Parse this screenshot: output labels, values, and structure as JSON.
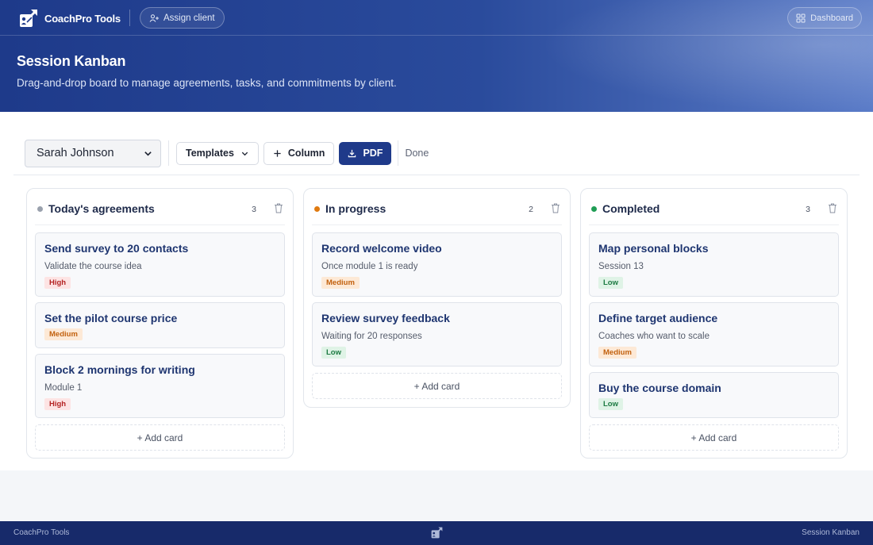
{
  "app": {
    "brand": "CoachPro Tools"
  },
  "topbar": {
    "assign_label": "Assign client",
    "dashboard_label": "Dashboard"
  },
  "hero": {
    "title": "Session Kanban",
    "subtitle": "Drag-and-drop board to manage agreements, tasks, and commitments by client."
  },
  "toolbar": {
    "client_selected": "Sarah Johnson",
    "templates_label": "Templates",
    "column_label": "Column",
    "pdf_label": "PDF",
    "status_label": "Done"
  },
  "colors": {
    "accent": "#1f3a8a",
    "dot_gray": "#9aa1ad",
    "dot_orange": "#e07a10",
    "dot_green": "#1f9d55"
  },
  "columns": [
    {
      "title": "Today's agreements",
      "count": "3",
      "cards": [
        {
          "title": "Send survey to 20 contacts",
          "subtitle": "Validate the course idea",
          "priority": "High"
        },
        {
          "title": "Set the pilot course price",
          "subtitle": "",
          "priority": "Medium"
        },
        {
          "title": "Block 2 mornings for writing",
          "subtitle": "Module 1",
          "priority": "High"
        }
      ],
      "add_label": "+ Add card"
    },
    {
      "title": "In progress",
      "count": "2",
      "cards": [
        {
          "title": "Record welcome video",
          "subtitle": "Once module 1 is ready",
          "priority": "Medium"
        },
        {
          "title": "Review survey feedback",
          "subtitle": "Waiting for 20 responses",
          "priority": "Low"
        }
      ],
      "add_label": "+ Add card"
    },
    {
      "title": "Completed",
      "count": "3",
      "cards": [
        {
          "title": "Map personal blocks",
          "subtitle": "Session 13",
          "priority": "Low"
        },
        {
          "title": "Define target audience",
          "subtitle": "Coaches who want to scale",
          "priority": "Medium"
        },
        {
          "title": "Buy the course domain",
          "subtitle": "",
          "priority": "Low"
        }
      ],
      "add_label": "+ Add card"
    }
  ],
  "footer": {
    "left": "CoachPro Tools",
    "right": "Session Kanban"
  }
}
